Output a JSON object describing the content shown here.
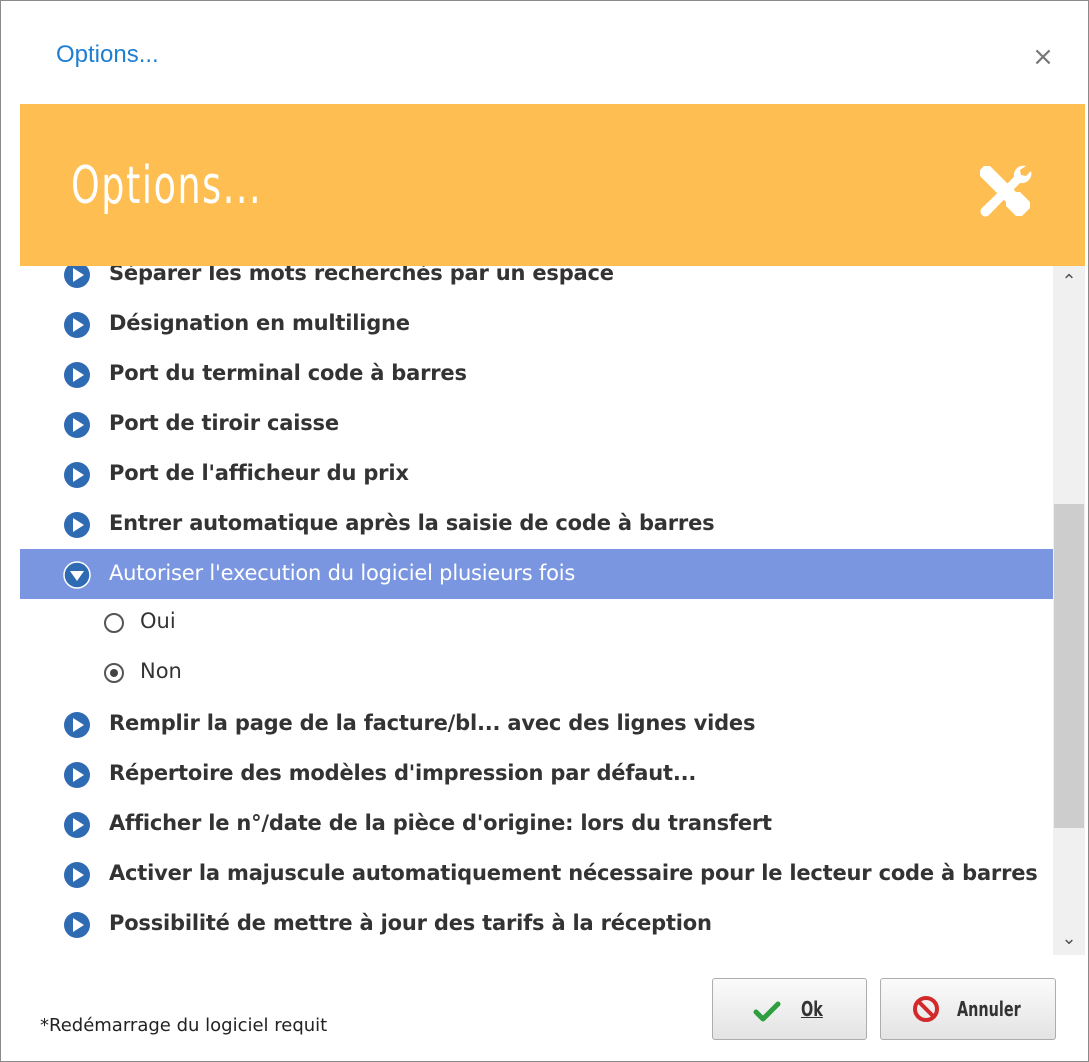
{
  "window": {
    "title": "Options...",
    "close_glyph": "×"
  },
  "banner": {
    "title": "Options...",
    "icon": "tools-icon",
    "color": "#ffbe51"
  },
  "options_list": {
    "items": [
      {
        "label": "Séparer les mots recherchés par un espace",
        "expanded": false
      },
      {
        "label": "Désignation en multiligne",
        "expanded": false
      },
      {
        "label": "Port du terminal code à barres",
        "expanded": false
      },
      {
        "label": "Port de tiroir caisse",
        "expanded": false
      },
      {
        "label": "Port de l'afficheur du prix",
        "expanded": false
      },
      {
        "label": "Entrer automatique après la saisie de code à barres",
        "expanded": false
      },
      {
        "label": "Autoriser l'execution du logiciel plusieurs fois",
        "expanded": true,
        "selected": true
      },
      {
        "label": "Remplir la page de la facture/bl... avec des lignes vides",
        "expanded": false
      },
      {
        "label": "Répertoire des modèles d'impression par défaut...",
        "expanded": false
      },
      {
        "label": "Afficher le n°/date de la pièce d'origine: lors du transfert",
        "expanded": false
      },
      {
        "label": "Activer la majuscule automatiquement nécessaire pour le lecteur code à barres",
        "expanded": false
      },
      {
        "label": "Possibilité de mettre à jour des tarifs à la réception",
        "expanded": false
      }
    ],
    "sub_options": [
      {
        "label": "Oui",
        "checked": false
      },
      {
        "label": "Non",
        "checked": true
      }
    ],
    "selected_color": "#7b96e0",
    "bullet_color": "#2f6bb3"
  },
  "footer": {
    "note": "*Redémarrage du logiciel requit",
    "ok_label": "Ok",
    "cancel_label": "Annuler"
  }
}
